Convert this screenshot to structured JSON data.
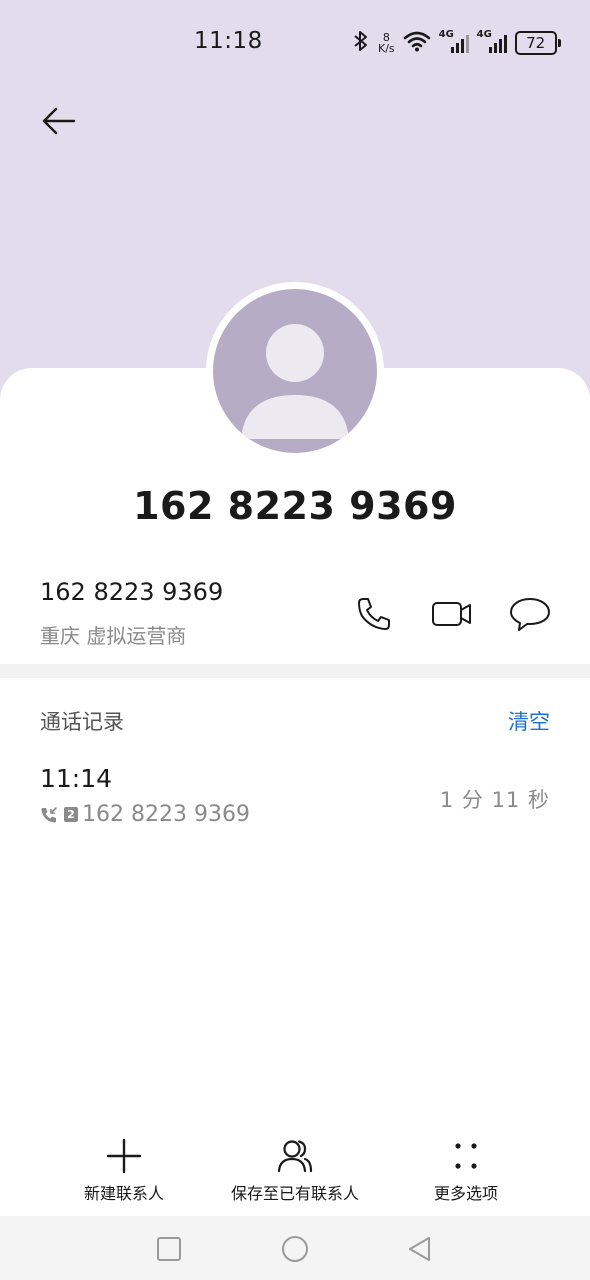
{
  "status_bar": {
    "time": "11:18",
    "speed_value": "8",
    "speed_unit": "K/s",
    "network_1": "4G",
    "network_2": "4G",
    "battery": "72"
  },
  "header": {
    "title_number": "162 8223 9369"
  },
  "contact": {
    "number": "162 8223 9369",
    "location": "重庆 虚拟运营商"
  },
  "call_log": {
    "section_title": "通话记录",
    "clear_label": "清空",
    "entries": [
      {
        "time": "11:14",
        "sim": "2",
        "number": "162 8223 9369",
        "duration": "1 分 11 秒"
      }
    ]
  },
  "bottom_actions": {
    "new_contact": "新建联系人",
    "save_existing": "保存至已有联系人",
    "more_options": "更多选项"
  },
  "colors": {
    "header_bg": "#e3dcec",
    "avatar_bg": "#b6acc6",
    "accent": "#1f6fd1"
  }
}
